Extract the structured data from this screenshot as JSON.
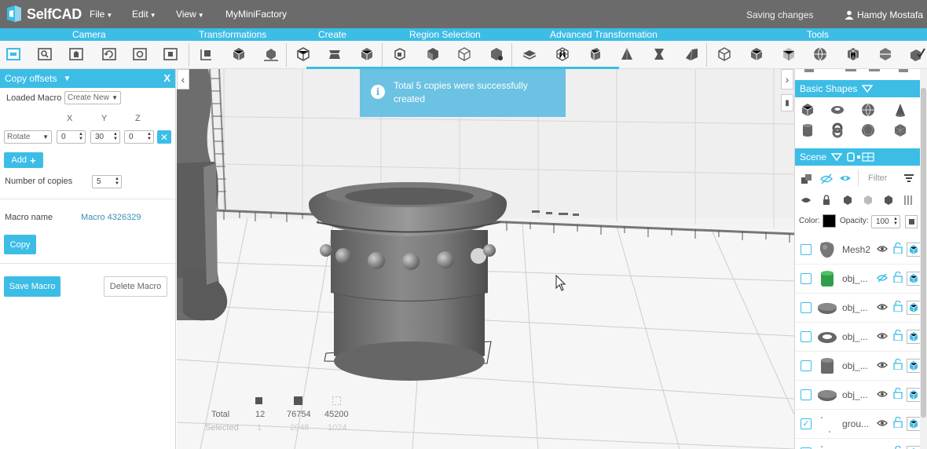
{
  "app": {
    "name": "SelfCAD"
  },
  "menu": [
    {
      "label": "File"
    },
    {
      "label": "Edit"
    },
    {
      "label": "View"
    },
    {
      "label": "MyMiniFactory"
    }
  ],
  "status": {
    "saving": "Saving changes",
    "user": "Hamdy Mostafa"
  },
  "categories": [
    {
      "label": "Camera"
    },
    {
      "label": "Transformations"
    },
    {
      "label": "Create"
    },
    {
      "label": "Region Selection"
    },
    {
      "label": "Advanced Transformation"
    },
    {
      "label": "Tools"
    }
  ],
  "left_panel": {
    "title": "Copy offsets",
    "close": "X",
    "loaded_macro_label": "Loaded Macro",
    "loaded_macro_value": "Create New",
    "axis_x": "X",
    "axis_y": "Y",
    "axis_z": "Z",
    "operation": "Rotate",
    "x_value": "0",
    "y_value": "30",
    "z_value": "0",
    "add_label": "Add",
    "copies_label": "Number of copies",
    "copies_value": "5",
    "macro_name_label": "Macro name",
    "macro_name_value": "Macro 4326329",
    "copy_label": "Copy",
    "save_macro_label": "Save Macro",
    "delete_macro_label": "Delete Macro"
  },
  "toast": {
    "message": "Total 5 copies were successfully created"
  },
  "stats": {
    "total_label": "Total",
    "selected_label": "Selected",
    "total_values": [
      "12",
      "76754",
      "45200"
    ],
    "selected_values": [
      "1",
      "2048",
      "1024"
    ]
  },
  "right_panel": {
    "basic_shapes_title": "Basic Shapes",
    "scene_title": "Scene",
    "filter_placeholder": "Filter",
    "color_label": "Color:",
    "color_value": "#000000",
    "opacity_label": "Opacity:",
    "opacity_value": "100",
    "scene_items": [
      {
        "name": "Mesh2",
        "checked": false,
        "thumb": "mesh"
      },
      {
        "name": "obj_...",
        "checked": false,
        "thumb": "green-cylinder"
      },
      {
        "name": "obj_...",
        "checked": false,
        "thumb": "disc"
      },
      {
        "name": "obj_...",
        "checked": false,
        "thumb": "torus"
      },
      {
        "name": "obj_...",
        "checked": false,
        "thumb": "cylinder"
      },
      {
        "name": "obj_...",
        "checked": false,
        "thumb": "disc"
      },
      {
        "name": "grou...",
        "checked": true,
        "thumb": "group"
      },
      {
        "name": "grou...",
        "checked": false,
        "thumb": "group"
      }
    ]
  },
  "colors": {
    "accent": "#3cbde6",
    "topbar": "#6b6b6b"
  }
}
